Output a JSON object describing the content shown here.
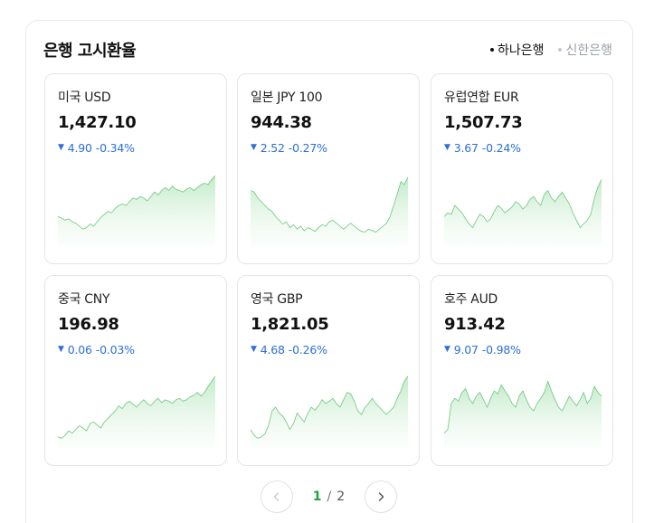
{
  "title": "은행 고시환율",
  "banks": [
    {
      "label": "하나은행",
      "active": true
    },
    {
      "label": "신한은행",
      "active": false
    }
  ],
  "cards": [
    {
      "name": "미국 USD",
      "rate": "1,427.10",
      "change": "4.90",
      "percent": "-0.34%",
      "trend": [
        0.35,
        0.33,
        0.3,
        0.32,
        0.28,
        0.26,
        0.22,
        0.18,
        0.2,
        0.25,
        0.22,
        0.28,
        0.34,
        0.38,
        0.42,
        0.4,
        0.46,
        0.5,
        0.52,
        0.5,
        0.55,
        0.6,
        0.58,
        0.62,
        0.6,
        0.56,
        0.62,
        0.68,
        0.64,
        0.7,
        0.74,
        0.7,
        0.76,
        0.72,
        0.7,
        0.68,
        0.72,
        0.74,
        0.7,
        0.74,
        0.78,
        0.8,
        0.78,
        0.85,
        0.9
      ]
    },
    {
      "name": "일본 JPY 100",
      "rate": "944.38",
      "change": "2.52",
      "percent": "-0.27%",
      "trend": [
        0.7,
        0.68,
        0.6,
        0.55,
        0.5,
        0.45,
        0.42,
        0.35,
        0.3,
        0.25,
        0.28,
        0.2,
        0.24,
        0.18,
        0.22,
        0.16,
        0.2,
        0.18,
        0.15,
        0.2,
        0.24,
        0.22,
        0.28,
        0.3,
        0.26,
        0.22,
        0.18,
        0.22,
        0.26,
        0.22,
        0.18,
        0.15,
        0.14,
        0.18,
        0.16,
        0.14,
        0.18,
        0.22,
        0.26,
        0.35,
        0.5,
        0.65,
        0.82,
        0.78,
        0.88
      ]
    },
    {
      "name": "유럽연합 EUR",
      "rate": "1,507.73",
      "change": "3.67",
      "percent": "-0.24%",
      "trend": [
        0.35,
        0.4,
        0.38,
        0.5,
        0.45,
        0.4,
        0.32,
        0.25,
        0.2,
        0.3,
        0.38,
        0.35,
        0.28,
        0.32,
        0.42,
        0.5,
        0.46,
        0.4,
        0.44,
        0.48,
        0.55,
        0.52,
        0.45,
        0.5,
        0.58,
        0.62,
        0.55,
        0.5,
        0.65,
        0.7,
        0.6,
        0.55,
        0.62,
        0.68,
        0.6,
        0.52,
        0.4,
        0.3,
        0.2,
        0.25,
        0.3,
        0.38,
        0.6,
        0.75,
        0.85
      ]
    },
    {
      "name": "중국 CNY",
      "rate": "196.98",
      "change": "0.06",
      "percent": "-0.03%",
      "trend": [
        0.1,
        0.08,
        0.12,
        0.18,
        0.15,
        0.2,
        0.25,
        0.22,
        0.18,
        0.28,
        0.3,
        0.26,
        0.22,
        0.3,
        0.35,
        0.4,
        0.45,
        0.52,
        0.48,
        0.55,
        0.58,
        0.54,
        0.5,
        0.56,
        0.6,
        0.55,
        0.52,
        0.58,
        0.62,
        0.56,
        0.6,
        0.58,
        0.55,
        0.6,
        0.62,
        0.58,
        0.6,
        0.64,
        0.66,
        0.7,
        0.65,
        0.7,
        0.78,
        0.85,
        0.92
      ]
    },
    {
      "name": "영국 GBP",
      "rate": "1,821.05",
      "change": "4.68",
      "percent": "-0.26%",
      "trend": [
        0.2,
        0.12,
        0.08,
        0.1,
        0.14,
        0.25,
        0.45,
        0.5,
        0.42,
        0.38,
        0.3,
        0.2,
        0.28,
        0.42,
        0.36,
        0.3,
        0.42,
        0.5,
        0.46,
        0.52,
        0.6,
        0.55,
        0.58,
        0.62,
        0.55,
        0.5,
        0.6,
        0.7,
        0.68,
        0.58,
        0.45,
        0.4,
        0.5,
        0.55,
        0.62,
        0.55,
        0.5,
        0.45,
        0.4,
        0.45,
        0.5,
        0.62,
        0.72,
        0.85,
        0.92
      ]
    },
    {
      "name": "호주 AUD",
      "rate": "913.42",
      "change": "9.07",
      "percent": "-0.98%",
      "trend": [
        0.15,
        0.2,
        0.55,
        0.62,
        0.58,
        0.7,
        0.75,
        0.62,
        0.55,
        0.65,
        0.7,
        0.6,
        0.5,
        0.62,
        0.72,
        0.68,
        0.8,
        0.72,
        0.65,
        0.55,
        0.5,
        0.65,
        0.72,
        0.6,
        0.5,
        0.45,
        0.55,
        0.62,
        0.7,
        0.85,
        0.72,
        0.6,
        0.5,
        0.45,
        0.55,
        0.65,
        0.58,
        0.52,
        0.6,
        0.7,
        0.55,
        0.62,
        0.78,
        0.7,
        0.65
      ]
    }
  ],
  "pagination": {
    "current": "1",
    "separator": "/",
    "total": "2"
  }
}
